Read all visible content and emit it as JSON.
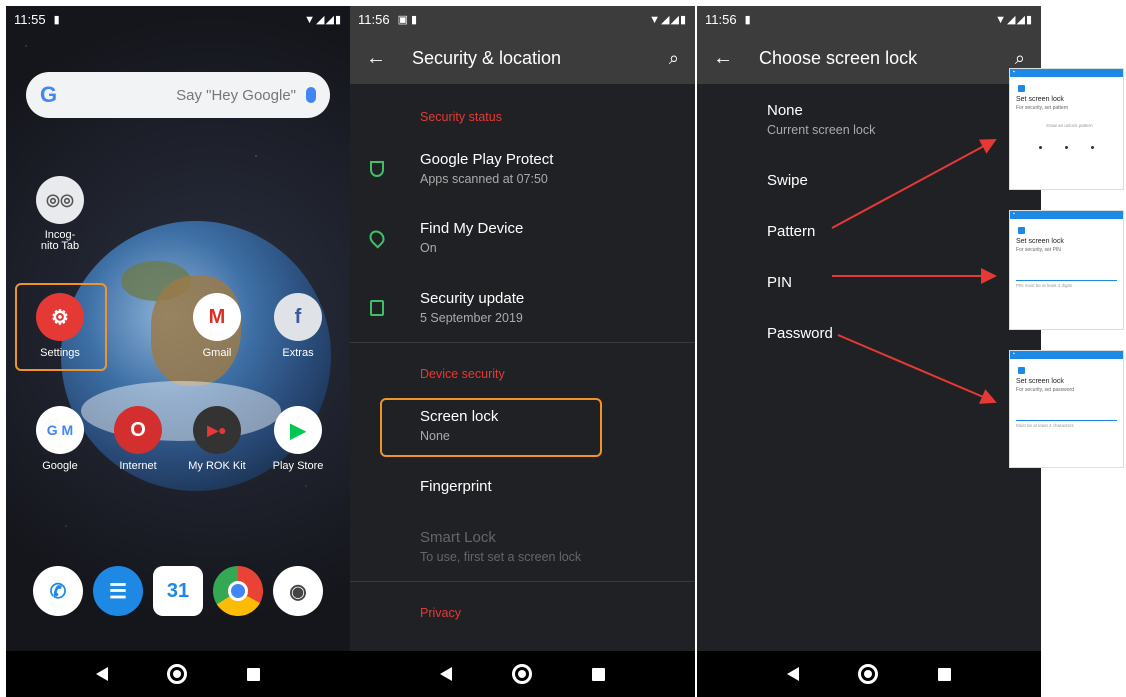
{
  "home": {
    "time": "11:55",
    "search_placeholder": "Say \"Hey Google\"",
    "apps": [
      {
        "label": "Incog-\nnito Tab",
        "icon": "incognito-chrome-icon"
      },
      {
        "label": "Settings",
        "icon": "gear-icon"
      },
      {
        "label": "Gmail",
        "icon": "gmail-icon"
      },
      {
        "label": "Extras",
        "icon": "folder-icon"
      },
      {
        "label": "Google",
        "icon": "google-folder-icon"
      },
      {
        "label": "Internet",
        "icon": "internet-icon"
      },
      {
        "label": "My ROK Kit",
        "icon": "rok-kit-icon"
      },
      {
        "label": "Play Store",
        "icon": "play-store-icon"
      }
    ],
    "dock_calendar_day": "31",
    "accent": "#f0942a"
  },
  "security": {
    "time": "11:56",
    "title": "Security & location",
    "section_status": "Security status",
    "items_status": [
      {
        "title": "Google Play Protect",
        "subtitle": "Apps scanned at 07:50"
      },
      {
        "title": "Find My Device",
        "subtitle": "On"
      },
      {
        "title": "Security update",
        "subtitle": "5 September 2019"
      }
    ],
    "section_device": "Device security",
    "items_device": [
      {
        "title": "Screen lock",
        "subtitle": "None"
      },
      {
        "title": "Fingerprint",
        "subtitle": ""
      },
      {
        "title": "Smart Lock",
        "subtitle": "To use, first set a screen lock"
      }
    ],
    "section_privacy": "Privacy"
  },
  "lock": {
    "time": "11:56",
    "title": "Choose screen lock",
    "options": [
      {
        "title": "None",
        "subtitle": "Current screen lock"
      },
      {
        "title": "Swipe",
        "subtitle": ""
      },
      {
        "title": "Pattern",
        "subtitle": ""
      },
      {
        "title": "PIN",
        "subtitle": ""
      },
      {
        "title": "Password",
        "subtitle": ""
      }
    ]
  },
  "thumbs": [
    {
      "title": "Set screen lock",
      "subtitle": "For security, set pattern",
      "hint": "Draw an unlock pattern"
    },
    {
      "title": "Set screen lock",
      "subtitle": "For security, set PIN",
      "hint": "PIN must be at least 4 digits"
    },
    {
      "title": "Set screen lock",
      "subtitle": "For security, set password",
      "hint": "Must be at least 4 characters"
    }
  ]
}
